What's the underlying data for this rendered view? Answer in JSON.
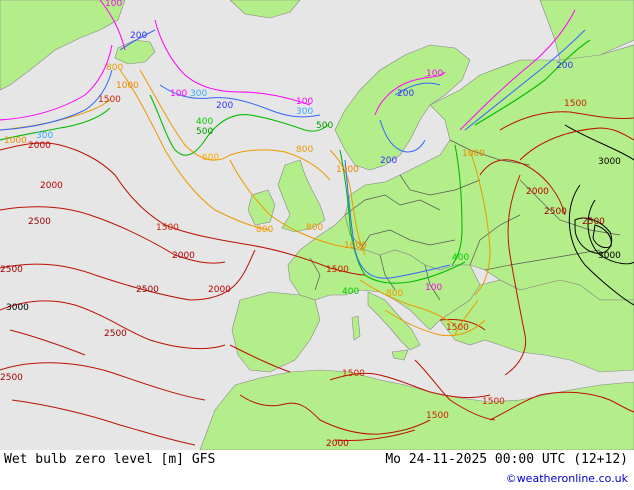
{
  "footer": {
    "title": "Wet bulb zero level [m] GFS",
    "valid_time": "Mo 24-11-2025 00:00 UTC (12+12)",
    "credit": "©weatheronline.co.uk"
  },
  "colors": {
    "sea": "#e6e6e6",
    "land": "#b4ee8a",
    "border": "#555555",
    "c100": "#ff00ff",
    "c200": "#3333ff",
    "c300": "#33aaff",
    "c400": "#00cc00",
    "c500": "#009900",
    "c600": "#ffaa00",
    "c800": "#ee9900",
    "c1000": "#ee8800",
    "c1500": "#cc2200",
    "c2000": "#bb0000",
    "c2500": "#990000",
    "c3000": "#000000"
  },
  "contour_labels": [
    {
      "text": "100",
      "level": "c100"
    },
    {
      "text": "200",
      "level": "c200"
    },
    {
      "text": "300",
      "level": "c300"
    },
    {
      "text": "400",
      "level": "c400"
    },
    {
      "text": "500",
      "level": "c500"
    },
    {
      "text": "600",
      "level": "c600"
    },
    {
      "text": "800",
      "level": "c800"
    },
    {
      "text": "1000",
      "level": "c1000"
    },
    {
      "text": "1500",
      "level": "c1500"
    },
    {
      "text": "2000",
      "level": "c2000"
    },
    {
      "text": "2500",
      "level": "c2500"
    },
    {
      "text": "3000",
      "level": "c3000"
    }
  ]
}
